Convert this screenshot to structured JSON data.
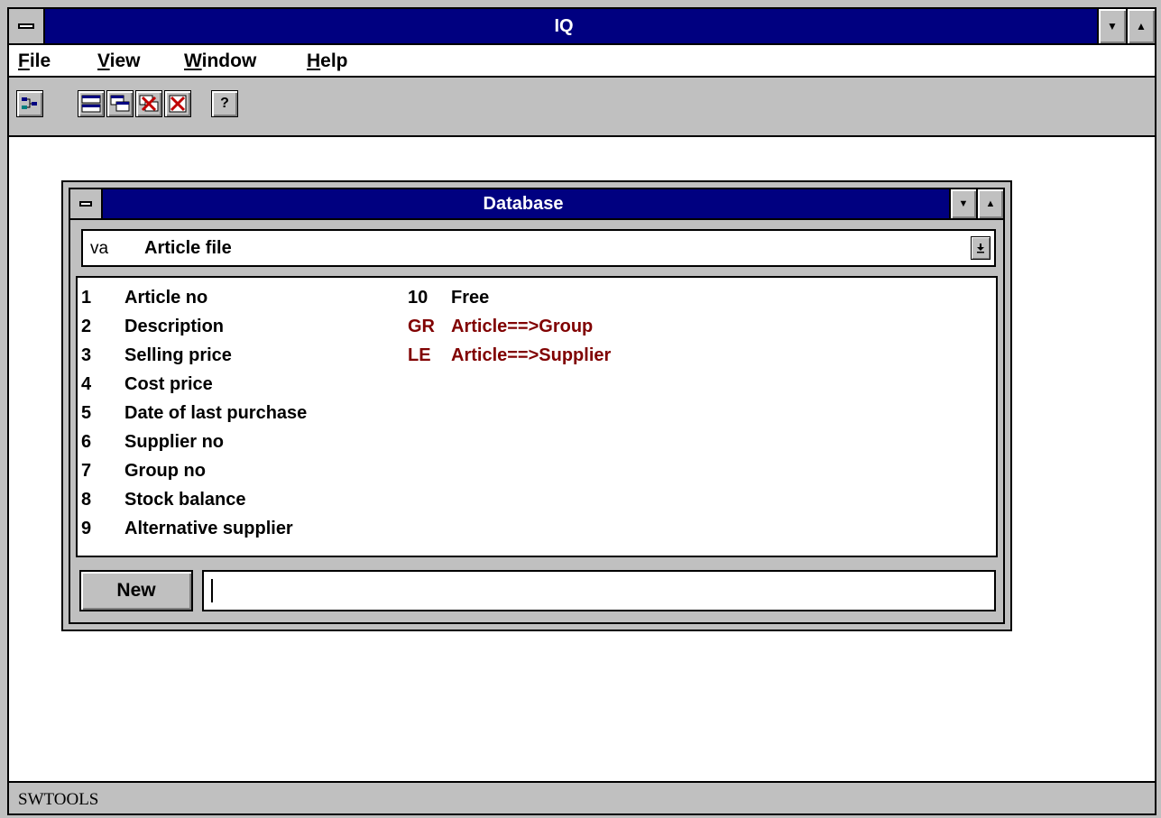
{
  "app": {
    "title": "IQ"
  },
  "menu": {
    "file": "File",
    "view": "View",
    "window": "Window",
    "help": "Help"
  },
  "toolbar": {
    "buttons": [
      "tree-icon",
      "windows-icon",
      "cascade-icon",
      "close-all-icon",
      "close-icon",
      "help-icon"
    ],
    "help_glyph": "?"
  },
  "db": {
    "title": "Database",
    "combo": {
      "code": "va",
      "label": "Article file"
    },
    "fields": [
      {
        "num": "1",
        "label": "Article no"
      },
      {
        "num": "2",
        "label": "Description"
      },
      {
        "num": "3",
        "label": "Selling price"
      },
      {
        "num": "4",
        "label": "Cost price"
      },
      {
        "num": "5",
        "label": "Date of last purchase"
      },
      {
        "num": "6",
        "label": "Supplier no"
      },
      {
        "num": "7",
        "label": "Group no"
      },
      {
        "num": "8",
        "label": "Stock balance"
      },
      {
        "num": "9",
        "label": "Alternative supplier"
      }
    ],
    "extra": [
      {
        "code": "10",
        "label": "Free"
      },
      {
        "code": "GR",
        "label": "Article==>Group"
      },
      {
        "code": "LE",
        "label": "Article==>Supplier"
      }
    ],
    "link_color": "#800000",
    "new_label": "New",
    "new_input_value": ""
  },
  "status": {
    "text": "SWTOOLS"
  },
  "colors": {
    "titlebar": "#000080",
    "face": "#c0c0c0"
  }
}
